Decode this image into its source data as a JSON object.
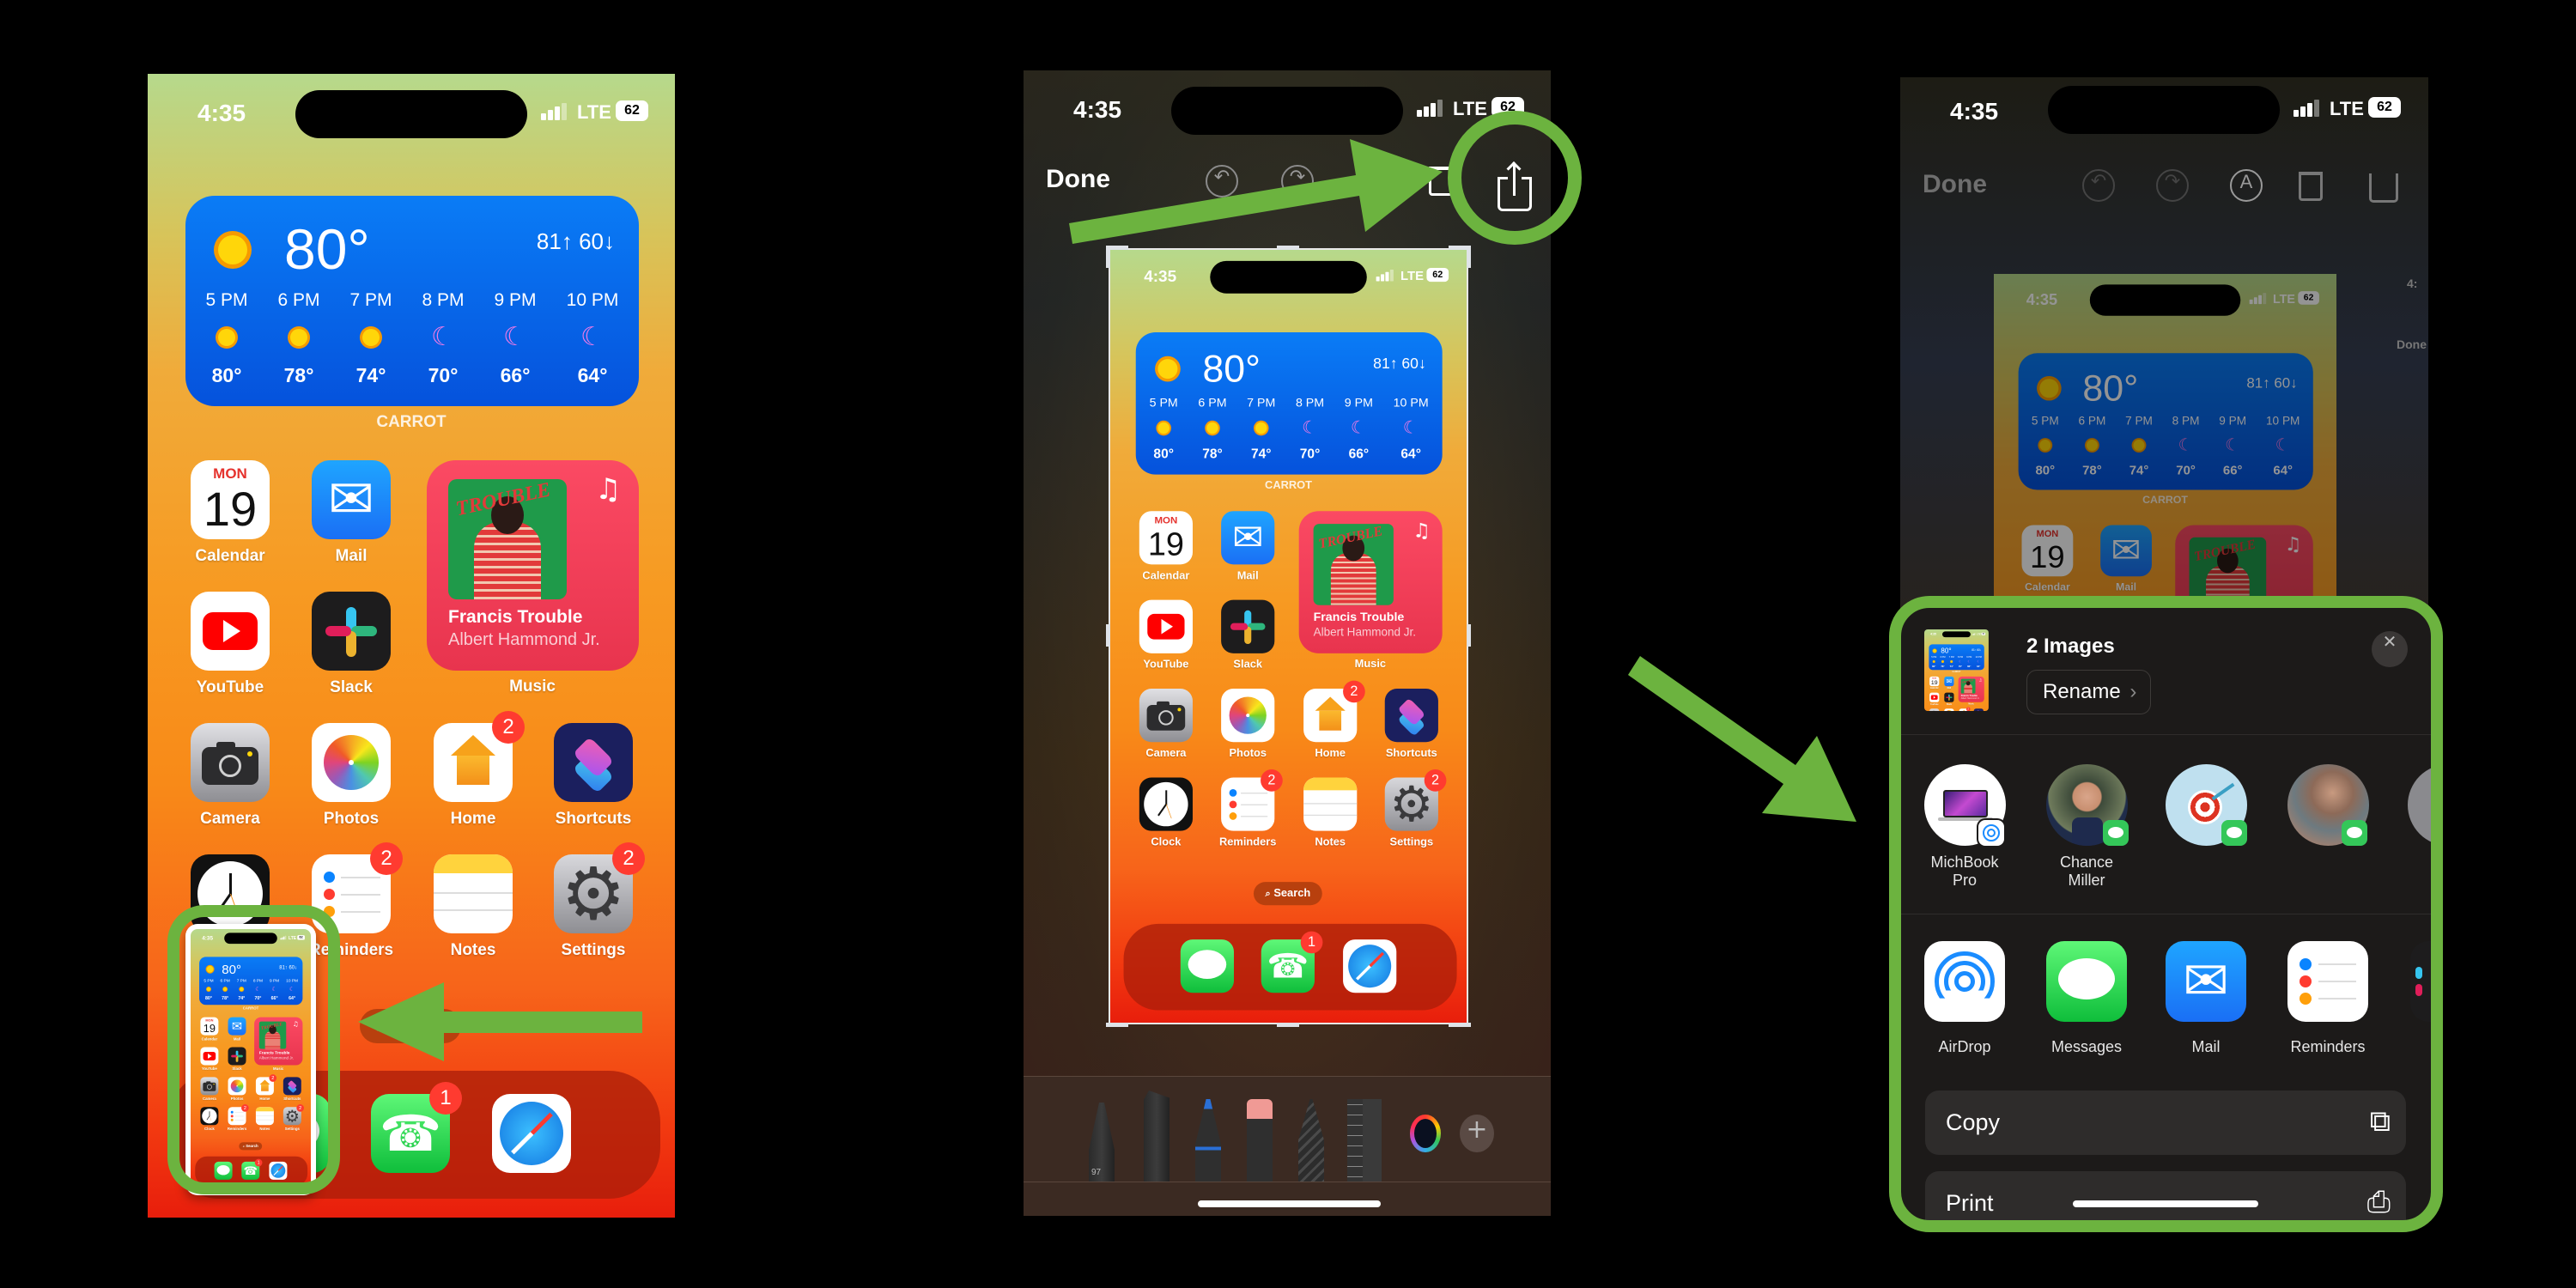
{
  "status_bar": {
    "time": "4:35",
    "network": "LTE",
    "battery": "62"
  },
  "home_screen": {
    "weather": {
      "current_temp": "80°",
      "high_low": "81↑ 60↓",
      "hours": [
        {
          "time": "5 PM",
          "temp": "80°",
          "icon": "sun"
        },
        {
          "time": "6 PM",
          "temp": "78°",
          "icon": "sun"
        },
        {
          "time": "7 PM",
          "temp": "74°",
          "icon": "sun"
        },
        {
          "time": "8 PM",
          "temp": "70°",
          "icon": "moon"
        },
        {
          "time": "9 PM",
          "temp": "66°",
          "icon": "moon"
        },
        {
          "time": "10 PM",
          "temp": "64°",
          "icon": "moon"
        }
      ],
      "widget_label": "CARROT"
    },
    "apps": [
      {
        "name": "Calendar",
        "icon": "calendar",
        "day": "MON",
        "date": "19"
      },
      {
        "name": "Mail",
        "icon": "mail"
      },
      {
        "name": "YouTube",
        "icon": "youtube"
      },
      {
        "name": "Slack",
        "icon": "slack"
      },
      {
        "name": "Camera",
        "icon": "camera"
      },
      {
        "name": "Photos",
        "icon": "photos"
      },
      {
        "name": "Home",
        "icon": "home",
        "badge": "2"
      },
      {
        "name": "Shortcuts",
        "icon": "shortcuts"
      },
      {
        "name": "Clock",
        "icon": "clock"
      },
      {
        "name": "Reminders",
        "icon": "reminders",
        "badge": "2"
      },
      {
        "name": "Notes",
        "icon": "notes"
      },
      {
        "name": "Settings",
        "icon": "settings",
        "badge": "2"
      }
    ],
    "music_widget": {
      "title": "Francis Trouble",
      "artist": "Albert Hammond Jr.",
      "label": "Music",
      "note_glyph": "♫"
    },
    "search_label": "Search",
    "dock": [
      {
        "name": "Messages",
        "icon": "messages"
      },
      {
        "name": "Phone",
        "icon": "phone",
        "badge": "1"
      },
      {
        "name": "Safari",
        "icon": "safari"
      }
    ]
  },
  "editor": {
    "done_label": "Done",
    "toolbar_icons": [
      "undo-icon",
      "redo-icon",
      "markup-icon",
      "trash-icon",
      "share-icon"
    ],
    "undo_glyph": "↶",
    "redo_glyph": "↷",
    "markup_glyph": "A",
    "trash_glyph": "🗑",
    "share_glyph": "⇧",
    "pen_width_label": "97",
    "add_glyph": "+",
    "second_image_time": "4:",
    "second_image_done": "Done"
  },
  "share_sheet": {
    "title": "2 Images",
    "rename_label": "Rename",
    "rename_chevron": "›",
    "close_glyph": "✕",
    "people": [
      {
        "label_line1": "MichBook",
        "label_line2": "Pro",
        "badge": "airdrop"
      },
      {
        "label_line1": "Chance",
        "label_line2": "Miller",
        "badge": "messages"
      },
      {
        "label_line1": "",
        "label_line2": "",
        "badge": "messages"
      },
      {
        "label_line1": "",
        "label_line2": "",
        "badge": "messages"
      }
    ],
    "apps": [
      {
        "name": "AirDrop",
        "icon": "airdrop"
      },
      {
        "name": "Messages",
        "icon": "messages"
      },
      {
        "name": "Mail",
        "icon": "mail"
      },
      {
        "name": "Reminders",
        "icon": "reminders"
      }
    ],
    "actions": [
      {
        "label": "Copy",
        "icon": "copy-icon",
        "glyph": "⧉"
      },
      {
        "label": "Print",
        "icon": "printer-icon",
        "glyph": "⎙"
      }
    ]
  },
  "colors": {
    "annotation_green": "#6cb33f",
    "badge_red": "#ff3b30",
    "sheet_bg": "#1c1a19"
  }
}
